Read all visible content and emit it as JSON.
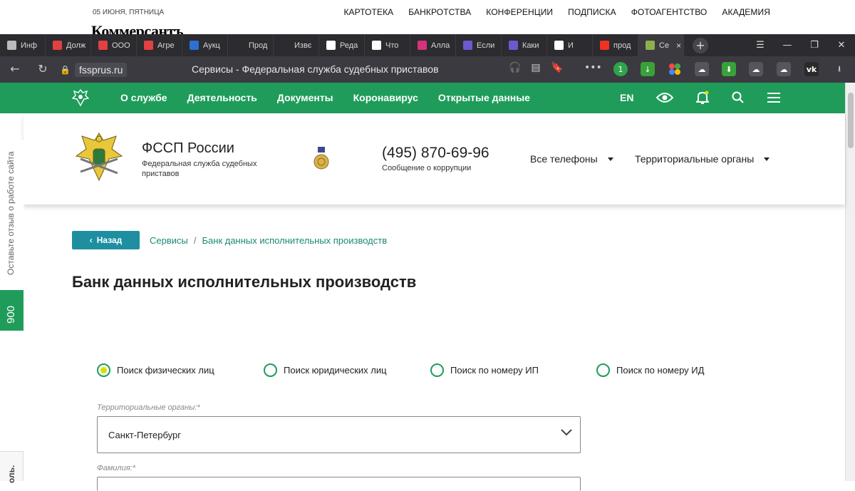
{
  "kommersant": {
    "date": "05 ИЮНЯ, ПЯТНИЦА",
    "logo": "Коммерсантъ",
    "nav": [
      "КАРТОТЕКА",
      "БАНКРОТСТВА",
      "КОНФЕРЕНЦИИ",
      "ПОДПИСКА",
      "ФОТОАГЕНТСТВО",
      "АКАДЕМИЯ"
    ]
  },
  "browser": {
    "tabs": [
      {
        "label": "Инф",
        "color": "#bbbbbb"
      },
      {
        "label": "Долж",
        "color": "#e34040"
      },
      {
        "label": "ООО",
        "color": "#e34040"
      },
      {
        "label": "Агре",
        "color": "#e34040"
      },
      {
        "label": "Аукц",
        "color": "#2e6fd6"
      },
      {
        "label": "Прод",
        "color": "#2b2b30"
      },
      {
        "label": "Извє",
        "color": "#2b2b30"
      },
      {
        "label": "Реда",
        "color": "#ffffff"
      },
      {
        "label": "Что",
        "color": "#ffffff"
      },
      {
        "label": "Алла",
        "color": "#d6337a"
      },
      {
        "label": "Если",
        "color": "#6a5acd"
      },
      {
        "label": "Каки",
        "color": "#6a5acd"
      },
      {
        "label": "И",
        "color": "#ffffff"
      },
      {
        "label": "прод",
        "color": "#e32"
      },
      {
        "label": "Се",
        "color": "#8db04c",
        "active": true
      }
    ],
    "url": "fssprus.ru",
    "page_title": "Сервисы - Федеральная служба судебных приставов",
    "new_tab_symbol": "+",
    "tab_close_symbol": "×"
  },
  "sitenav": {
    "items": [
      "О службе",
      "Деятельность",
      "Документы",
      "Коронавирус",
      "Открытые данные"
    ],
    "lang": "EN"
  },
  "header": {
    "org_title": "ФССП России",
    "org_subtitle": "Федеральная служба судебных приставов",
    "phone": "(495) 870-69-96",
    "phone_subtitle": "Сообщение о коррупции",
    "all_phones": "Все телефоны",
    "territorial": "Территориальные органы"
  },
  "sidebar": {
    "feedback": "Оставьте отзыв о работе сайта",
    "badge": "900",
    "bottom_text": "оль."
  },
  "main": {
    "back_label": "Назад",
    "breadcrumb": [
      "Сервисы",
      "Банк данных исполнительных производств"
    ],
    "breadcrumb_sep": "/",
    "title": "Банк данных исполнительных производств",
    "search_modes": [
      {
        "label": "Поиск физических лиц",
        "checked": true
      },
      {
        "label": "Поиск юридических лиц",
        "checked": false
      },
      {
        "label": "Поиск по номеру ИП",
        "checked": false
      },
      {
        "label": "Поиск по номеру ИД",
        "checked": false
      }
    ],
    "territorial_label": "Территориальные органы:*",
    "territorial_value": "Санкт-Петербург",
    "surname_label": "Фамилия:*"
  },
  "colors": {
    "brand_green": "#1f9c5a",
    "back_button": "#1e8fa0",
    "link": "#1a8a74",
    "radio_fill": "#d8e000"
  }
}
